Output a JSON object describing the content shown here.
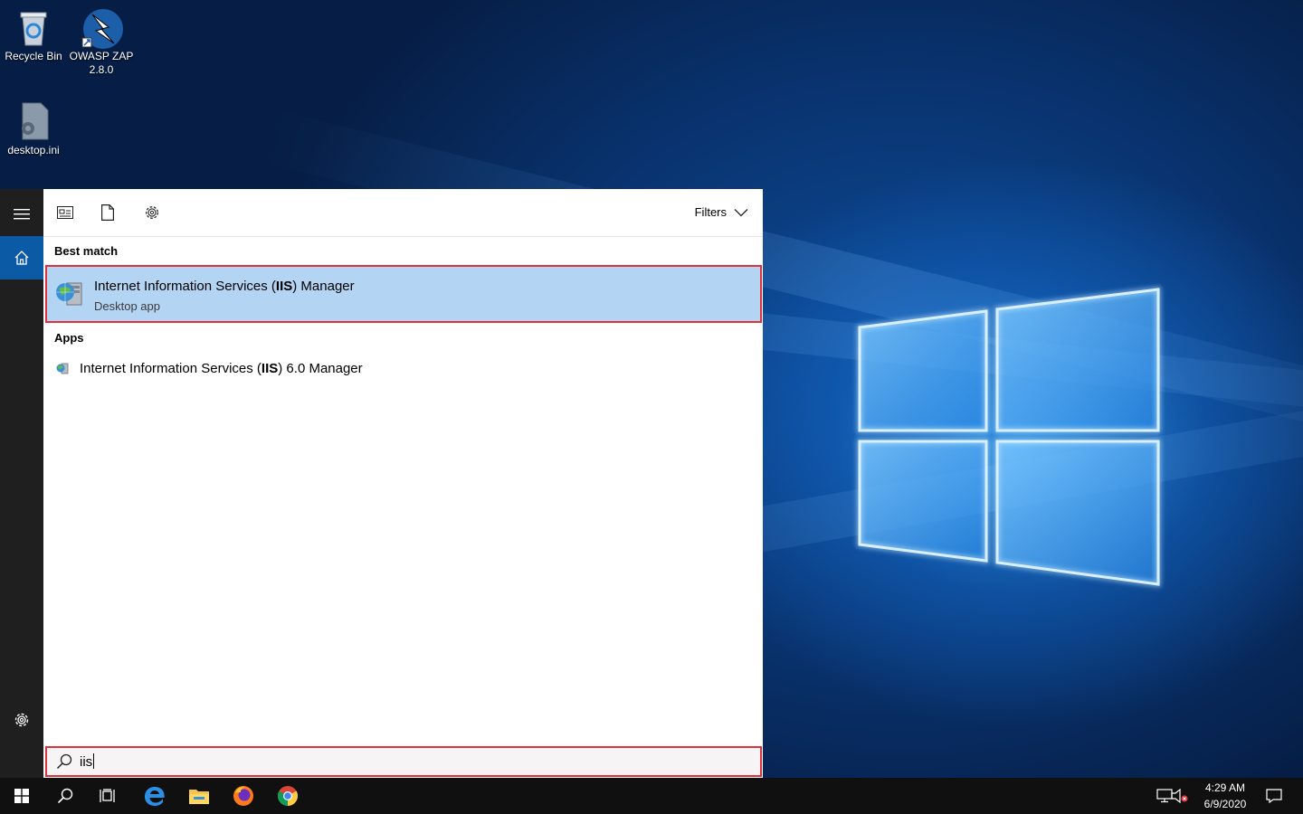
{
  "desktop": {
    "icons": [
      {
        "label": "Recycle Bin"
      },
      {
        "label": "OWASP ZAP",
        "label2": "2.8.0"
      },
      {
        "label": "desktop.ini"
      }
    ]
  },
  "start_menu": {
    "filters_label": "Filters",
    "best_match_header": "Best match",
    "best_match": {
      "title_pre": "Internet Information Services (",
      "title_bold": "IIS",
      "title_post": ") Manager",
      "subtitle": "Desktop app"
    },
    "apps_header": "Apps",
    "apps": [
      {
        "title_pre": "Internet Information Services (",
        "title_bold": "IIS",
        "title_post": ") 6.0 Manager"
      }
    ],
    "search_query": "iis"
  },
  "taskbar": {
    "time": "4:29 AM",
    "date": "6/9/2020"
  },
  "colors": {
    "selection": "#b3d4f2",
    "highlight_border": "#e0323a",
    "rail": "#1f1f1f",
    "home_accent": "#0b5aa6",
    "taskbar": "#101010"
  },
  "icons": [
    "recycle-bin-icon",
    "zap-icon",
    "settings-file-icon",
    "hamburger-icon",
    "home-icon",
    "gear-icon",
    "documents-icon",
    "apps-icon",
    "chevron-down-icon",
    "iis-icon",
    "search-icon",
    "windows-logo-icon",
    "task-view-icon",
    "edge-icon",
    "file-explorer-icon",
    "firefox-icon",
    "chrome-icon",
    "network-icon",
    "volume-icon",
    "notification-icon"
  ]
}
